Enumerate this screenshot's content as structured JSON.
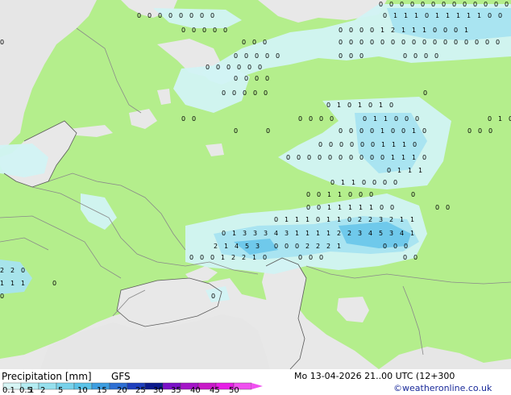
{
  "title": "Precipitation [mm]",
  "model": "GFS",
  "valid_time": "Mo 13-04-2026 21..00 UTC (12+300",
  "credit": "©weatheronline.co.uk",
  "colorbar": {
    "ticks": [
      "0.1",
      "0.5",
      "1",
      "2",
      "5",
      "10",
      "15",
      "20",
      "25",
      "30",
      "35",
      "40",
      "45",
      "50"
    ],
    "colors": [
      "#d6f5f5",
      "#b4ecf2",
      "#96e0ee",
      "#78d2eb",
      "#5ac3e8",
      "#3c9de0",
      "#2e6fd4",
      "#1e3fbe",
      "#0b1a8c",
      "#7a10c8",
      "#a415c8",
      "#c81ac8",
      "#e61ee6",
      "#f050f0"
    ]
  },
  "colors": {
    "land": "#b4ee8c",
    "sea": "#e8e8e8",
    "outside_land": "#e6e6e6",
    "precip_light": "#d2f3f4",
    "precip_medium": "#a7e3f0",
    "precip_strong": "#6cc7ea"
  },
  "precip_labels": [
    {
      "text": "0"
    },
    {
      "text": "1"
    },
    {
      "text": "2"
    },
    {
      "text": "3"
    },
    {
      "text": "4"
    },
    {
      "text": "5"
    }
  ]
}
